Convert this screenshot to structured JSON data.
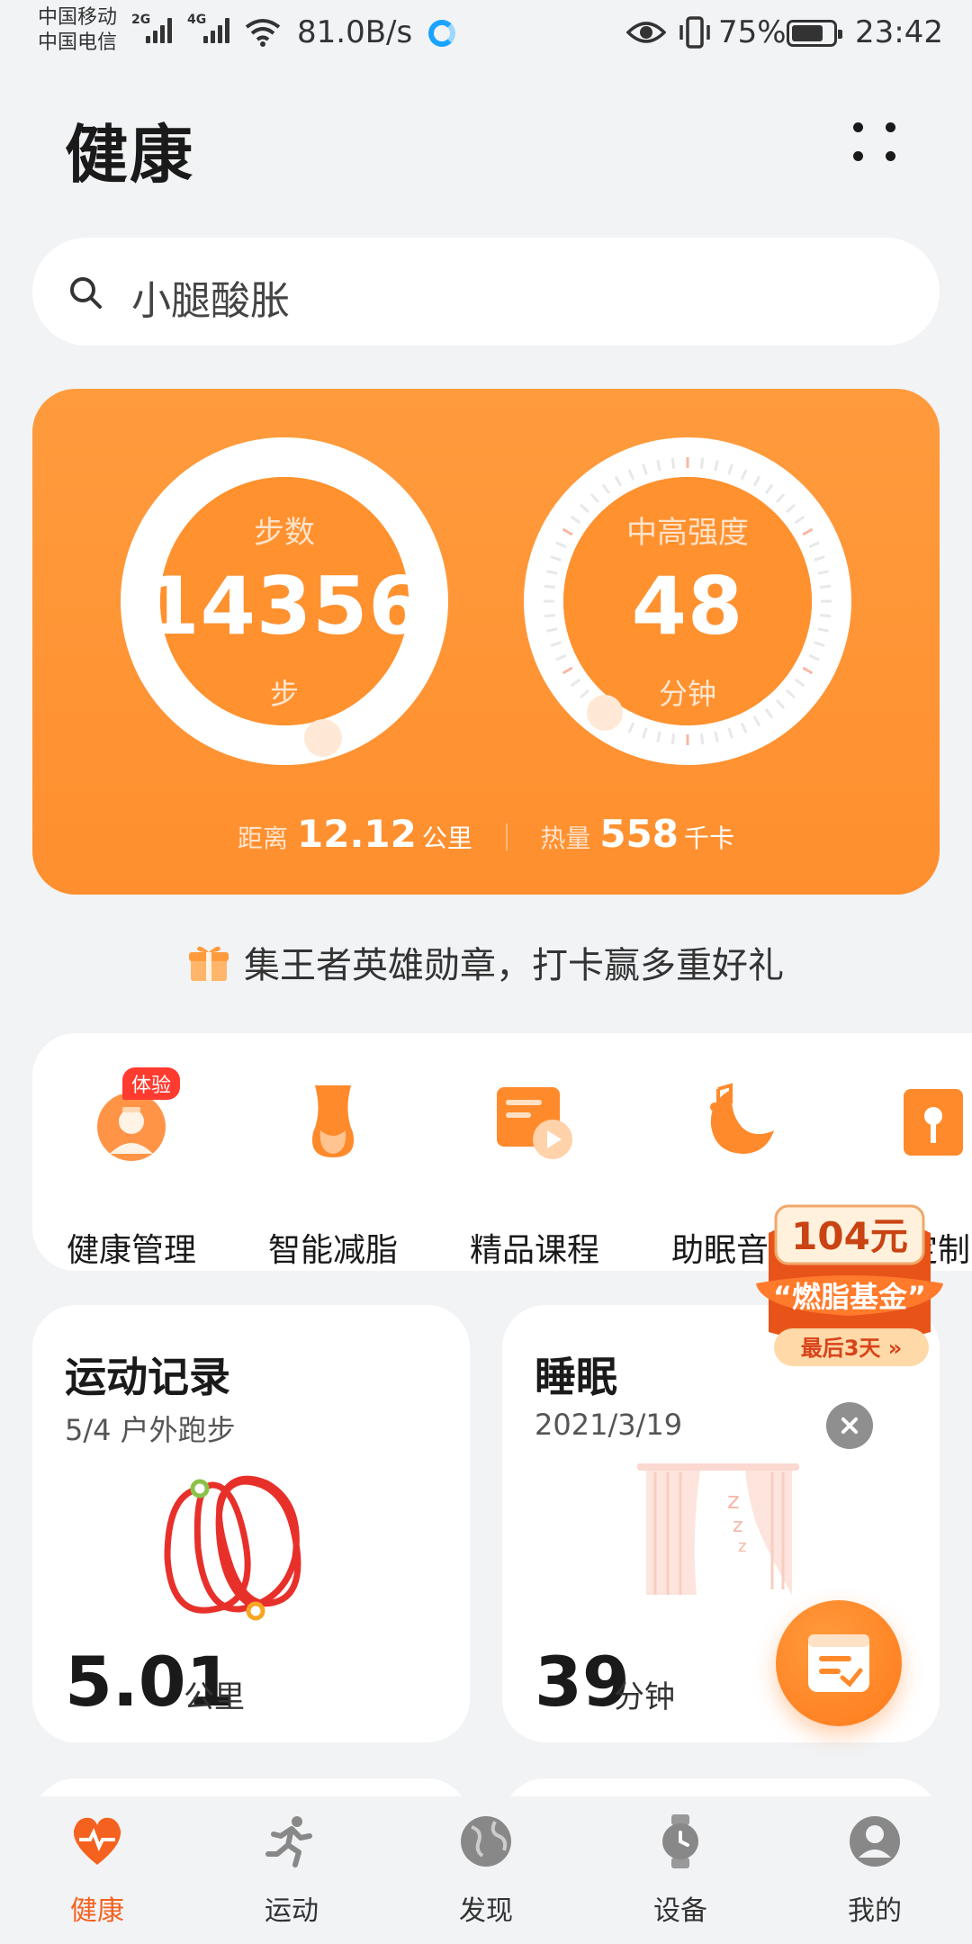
{
  "status_bar": {
    "carrier1": "中国移动",
    "carrier2": "中国电信",
    "net1": "2G",
    "net2": "4G",
    "speed": "81.0B/s",
    "battery": "75%",
    "time": "23:42"
  },
  "header": {
    "title": "健康"
  },
  "search": {
    "placeholder": "小腿酸胀"
  },
  "activity": {
    "steps": {
      "label": "步数",
      "value": "14356",
      "unit": "步",
      "ring_progress": 0.95
    },
    "intensity": {
      "label": "中高强度",
      "value": "48",
      "unit": "分钟"
    },
    "distance": {
      "label": "距离",
      "value": "12.12",
      "unit": "公里"
    },
    "calories": {
      "label": "热量",
      "value": "558",
      "unit": "千卡"
    }
  },
  "promo": {
    "text": "集王者英雄勋章，打卡赢多重好礼"
  },
  "quick_menu": {
    "items": [
      {
        "label": "健康管理",
        "badge": "体验",
        "icon": "doctor-icon"
      },
      {
        "label": "智能减脂",
        "icon": "waist-icon"
      },
      {
        "label": "精品课程",
        "icon": "course-icon"
      },
      {
        "label": "助眠音乐",
        "icon": "moon-music-icon"
      },
      {
        "label": "定制",
        "icon": "custom-icon"
      }
    ]
  },
  "fund": {
    "amount": "104元",
    "name": "“燃脂基金”",
    "cta": "最后3天 »"
  },
  "cards": {
    "exercise": {
      "title": "运动记录",
      "subtitle": "5/4 户外跑步",
      "value": "5.01",
      "unit": "公里"
    },
    "sleep": {
      "title": "睡眠",
      "subtitle": "2021/3/19",
      "value": "39",
      "unit": "分钟"
    }
  },
  "nav": {
    "items": [
      {
        "label": "健康",
        "active": true
      },
      {
        "label": "运动"
      },
      {
        "label": "发现"
      },
      {
        "label": "设备"
      },
      {
        "label": "我的"
      }
    ]
  },
  "colors": {
    "accent": "#f5611e",
    "card_orange": "#ff9b3d",
    "background": "#f1f3f5"
  }
}
